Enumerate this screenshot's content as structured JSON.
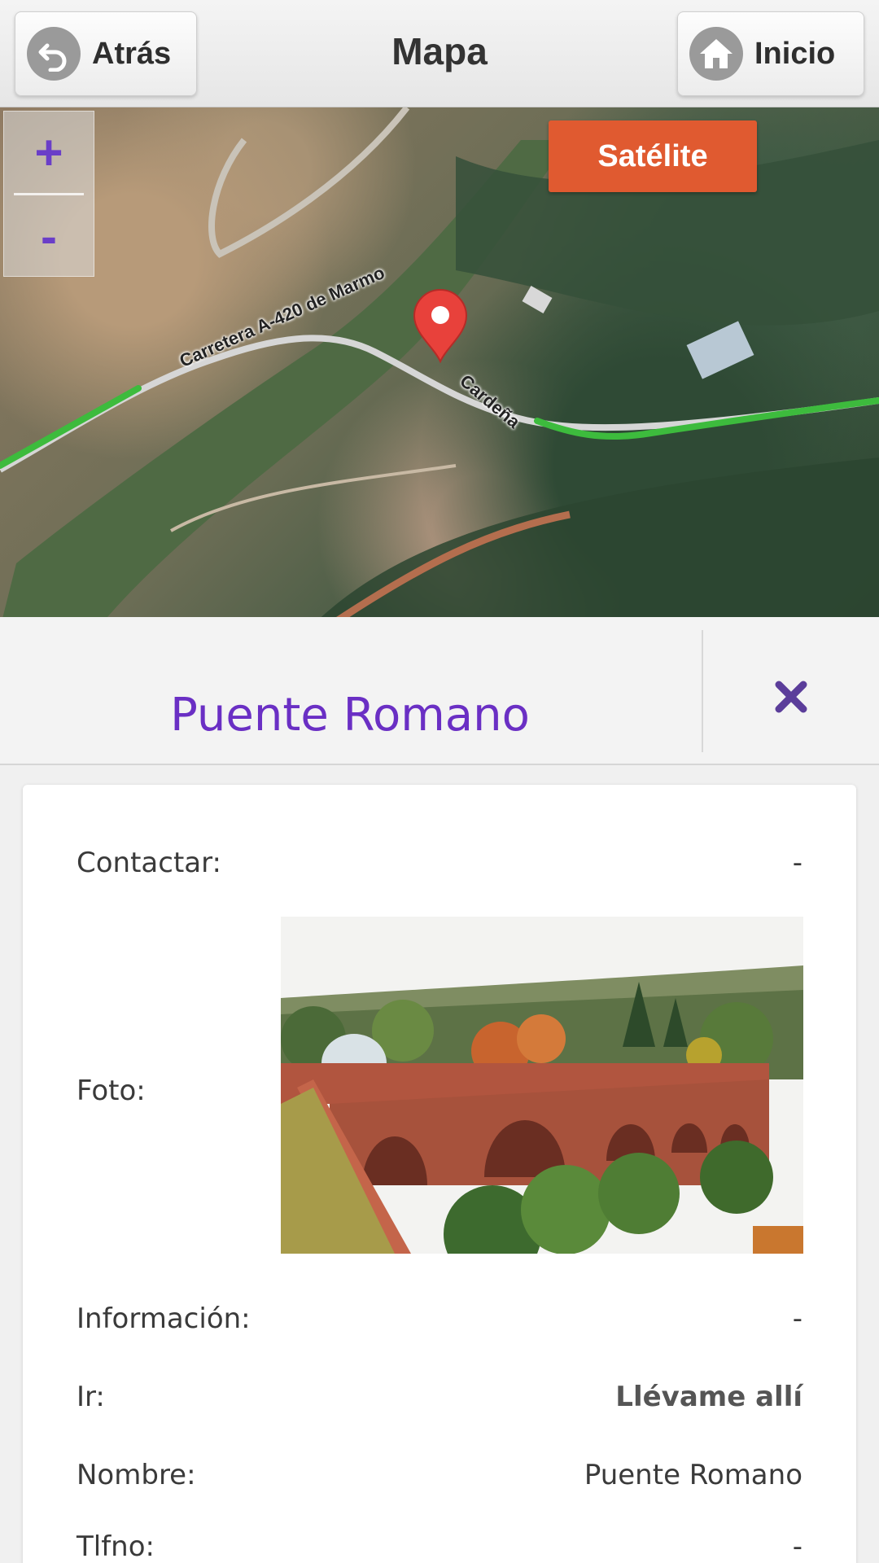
{
  "header": {
    "back_label": "Atrás",
    "title": "Mapa",
    "home_label": "Inicio",
    "icons": {
      "back": "undo-arrow-icon",
      "home": "house-icon"
    }
  },
  "map": {
    "zoom_in": "+",
    "zoom_out": "-",
    "satellite_label": "Satélite",
    "road_labels": [
      "Carretera A-420 de Marmo",
      "Cardeña"
    ],
    "colors": {
      "satellite_button": "#e05a30",
      "route": "#3dbb3d",
      "pin": "#e8413b",
      "zoom_text": "#6a3ec8"
    }
  },
  "poi": {
    "title": "Puente Romano",
    "close_icon": "close-x-icon",
    "title_color": "#6a2fc4"
  },
  "details": [
    {
      "label": "Contactar:",
      "value": "-"
    },
    {
      "label": "Foto:",
      "value": ""
    },
    {
      "label": "Información:",
      "value": "-"
    },
    {
      "label": "Ir:",
      "value": "Llévame allí"
    },
    {
      "label": "Nombre:",
      "value": "Puente Romano"
    },
    {
      "label": "Tlfno:",
      "value": "-"
    }
  ]
}
